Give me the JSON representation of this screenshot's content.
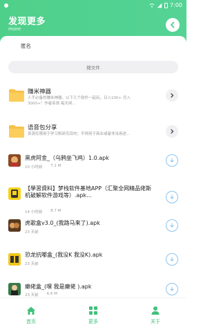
{
  "status": {
    "time": "7:00"
  },
  "header": {
    "title": "发现更多",
    "subtitle": "more"
  },
  "name_field": "匿名",
  "search": {
    "placeholder": "搜文件"
  },
  "folders": [
    {
      "title": "赚米神器",
      "desc": "人手必备的赚米神器，以下几个软件一起玩，日入100+ 月入3000+！作者亲测 每天闲..."
    },
    {
      "title": "语音包分享",
      "desc": "资源仅限用于学习和研究目的；不得用于商业或者非法用途..."
    }
  ],
  "files": [
    {
      "title": "黑虎阿金_（乌鸦坐飞鸡）1.0.apk",
      "age": "10 小时前",
      "size": "7.1 M"
    },
    {
      "title": "【學習資料】梦栈软件基地APP（汇聚全网精品佬斯机破解软件游戏等）.apk...",
      "age": "14 小时前",
      "size": "8.7 M"
    },
    {
      "title": "虎歌盒v3.0_(我路马来了).apk",
      "age": "23 天前",
      "size": ""
    },
    {
      "title": "恐龙抗嘟盒_(我没K 我没K).apk",
      "age": "23 天前",
      "size": ""
    },
    {
      "title": "癞佬盒_(嘿 我是癞佬 ).apk",
      "age": "23 天前",
      "size": "6.6 M"
    }
  ],
  "nav": [
    {
      "label": "首页",
      "icon": "home-icon"
    },
    {
      "label": "更多",
      "icon": "grid-icon"
    },
    {
      "label": "关于",
      "icon": "person-icon"
    }
  ],
  "colors": {
    "accent": "#4fd08a",
    "download": "#8cc4f0",
    "folder": "#f7c14a"
  }
}
